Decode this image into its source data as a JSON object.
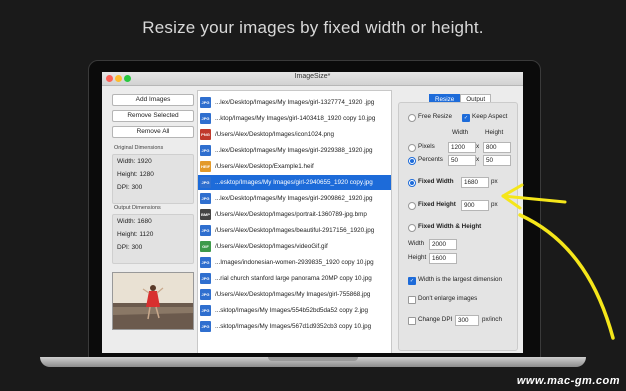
{
  "headline": "Resize your images by fixed width or height.",
  "window": {
    "title": "ImageSize*"
  },
  "left": {
    "buttons": {
      "add": "Add Images",
      "remove_selected": "Remove Selected",
      "remove_all": "Remove All"
    },
    "original": {
      "title": "Original Dimensions",
      "width": "Width: 1920",
      "height": "Height: 1280",
      "dpi": "DPI: 300"
    },
    "output": {
      "title": "Output Dimensions",
      "width": "Width: 1680",
      "height": "Height: 1120",
      "dpi": "DPI: 300"
    }
  },
  "files": [
    {
      "type": "JPG",
      "color": "#2f6fcf",
      "name": "...lex/Desktop/Images/My Images/girl-1327774_1920 .jpg"
    },
    {
      "type": "JPG",
      "color": "#2f6fcf",
      "name": "...ktop/Images/My Images/girl-1403418_1920 copy 10.jpg"
    },
    {
      "type": "PNG",
      "color": "#c0392b",
      "name": "/Users/Alex/Desktop/Images/icon1024.png"
    },
    {
      "type": "JPG",
      "color": "#2f6fcf",
      "name": "...lex/Desktop/Images/My Images/girl-2929388_1920.jpg"
    },
    {
      "type": "HEIF",
      "color": "#e39a2a",
      "name": "/Users/Alex/Desktop/Example1.heif"
    },
    {
      "type": "JPG",
      "color": "#2f6fcf",
      "name": "...esktop/Images/My Images/girl-2940655_1920 copy.jpg"
    },
    {
      "type": "JPG",
      "color": "#2f6fcf",
      "name": "...lex/Desktop/Images/My Images/girl-2909862_1920.jpg"
    },
    {
      "type": "BMP",
      "color": "#444444",
      "name": "/Users/Alex/Desktop/Images/portrait-1360789-jpg.bmp"
    },
    {
      "type": "JPG",
      "color": "#2f6fcf",
      "name": "/Users/Alex/Desktop/Images/beautiful-2917156_1920.jpg"
    },
    {
      "type": "GIF",
      "color": "#3d9a4a",
      "name": "/Users/Alex/Desktop/Images/videoGif.gif"
    },
    {
      "type": "JPG",
      "color": "#2f6fcf",
      "name": "...Images/indonesian-women-2939835_1920 copy 10.jpg"
    },
    {
      "type": "JPG",
      "color": "#2f6fcf",
      "name": "...rial church stanford large panorama 20MP copy 10.jpg"
    },
    {
      "type": "JPG",
      "color": "#2f6fcf",
      "name": "/Users/Alex/Desktop/Images/My Images/girl-755868.jpg"
    },
    {
      "type": "JPG",
      "color": "#2f6fcf",
      "name": "...sktop/Images/My Images/554b52bd5da52 copy 2.jpg"
    },
    {
      "type": "JPG",
      "color": "#2f6fcf",
      "name": "...sktop/Images/My Images/567d1d9352cb3 copy 10.jpg"
    }
  ],
  "selected_index": 5,
  "tabs": [
    "Resize",
    "Output"
  ],
  "resize": {
    "free_resize": "Free Resize",
    "keep_aspect": "Keep Aspect",
    "col_width": "Width",
    "col_height": "Height",
    "pixels": "Pixels",
    "pixels_w": "1200",
    "pixels_h": "800",
    "percents": "Percents",
    "percents_w": "50",
    "percents_h": "50",
    "x": "x",
    "fixed_width": "Fixed Width",
    "fixed_width_val": "1680",
    "fixed_height": "Fixed Height",
    "fixed_height_val": "900",
    "px": "px",
    "fixed_wh": "Fixed Width & Height",
    "fwh_width_label": "Width",
    "fwh_width_val": "2000",
    "fwh_height_label": "Height",
    "fwh_height_val": "1600",
    "largest_dim": "Width is the largest dimension",
    "dont_enlarge": "Don't enlarge images",
    "change_dpi": "Change DPI",
    "dpi_val": "300",
    "dpi_unit": "px/inch"
  },
  "watermark": "www.mac-gm.com",
  "colors": {
    "accent": "#1d6bd9",
    "highlight": "#f5e61a"
  }
}
